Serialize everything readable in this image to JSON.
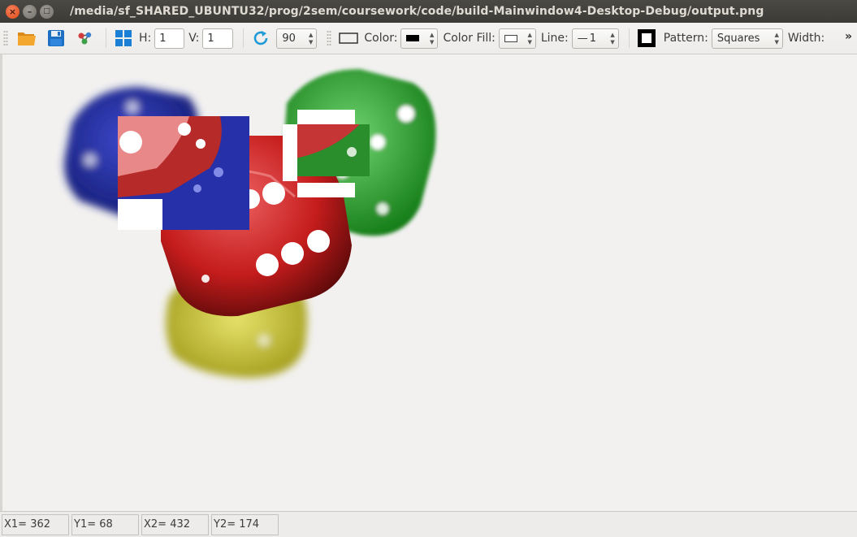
{
  "window": {
    "title": "/media/sf_SHARED_UBUNTU32/prog/2sem/coursework/code/build-Mainwindow4-Desktop-Debug/output.png",
    "close_glyph": "×",
    "minimize_glyph": "–",
    "maximize_glyph": "□"
  },
  "toolbar": {
    "open_icon": "folder-open-icon",
    "save_icon": "floppy-save-icon",
    "split_label": "H:",
    "split_h_value": "1",
    "split_v_label": "V:",
    "split_v_value": "1",
    "rotate_value": "90",
    "color_label": "Color:",
    "color_fill_label": "Color Fill:",
    "line_label": "Line:",
    "line_value": "1",
    "pattern_label": "Pattern:",
    "pattern_value": "Squares",
    "width_label": "Width:",
    "overflow_glyph": "»",
    "spin_up": "▲",
    "spin_down": "▼",
    "line_dash": "—"
  },
  "status": {
    "x1": "X1= 362",
    "y1": "Y1= 68",
    "x2": "X2= 432",
    "y2": "Y2= 174"
  },
  "colors": {
    "accent": "#df4a16",
    "rotate_icon": "#1e9ad6",
    "grid_icon": "#1b7fd6"
  }
}
